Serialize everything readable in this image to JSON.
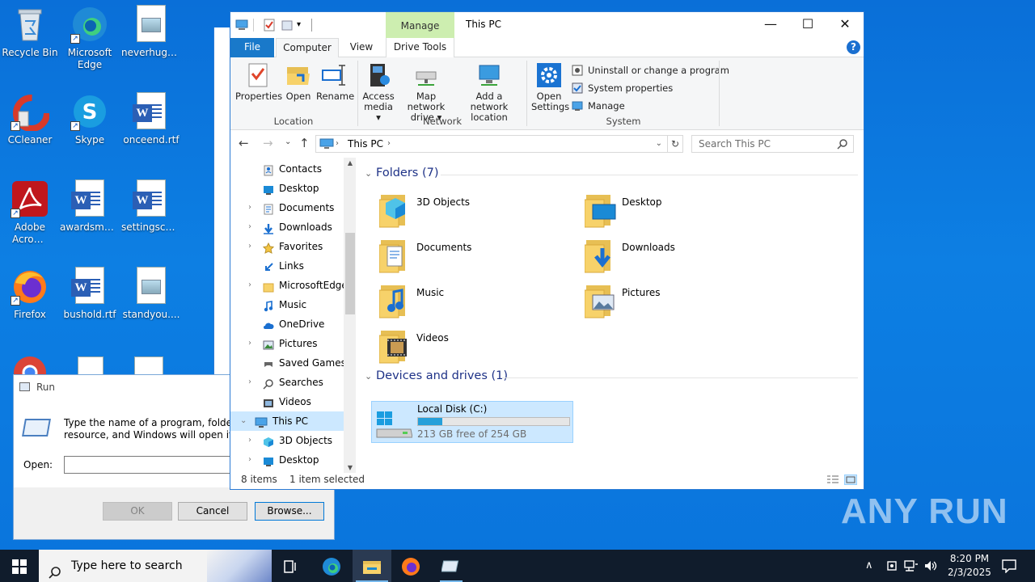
{
  "desktop": {
    "icons": [
      {
        "label": "Recycle Bin"
      },
      {
        "label": "Microsoft Edge"
      },
      {
        "label": "neverhuge..."
      },
      {
        "label": "CCleaner"
      },
      {
        "label": "Skype"
      },
      {
        "label": "onceend.rtf"
      },
      {
        "label": "Adobe Acrobat"
      },
      {
        "label": "awardsmar..."
      },
      {
        "label": "settingscho..."
      },
      {
        "label": "Firefox"
      },
      {
        "label": "bushold.rtf"
      },
      {
        "label": "standyou...."
      }
    ],
    "watermark": "ANY RUN"
  },
  "run_dialog": {
    "title": "Run",
    "description_line1": "Type the name of a program, folder, do",
    "description_line2": "resource, and Windows will open it for",
    "open_label": "Open:",
    "open_value": "",
    "ok_label": "OK",
    "cancel_label": "Cancel",
    "browse_label": "Browse..."
  },
  "explorer": {
    "manage_tab": "Manage",
    "title": "This PC",
    "controls": {
      "minimize": "—",
      "maximize": "☐",
      "close": "✕"
    },
    "tabs": [
      {
        "label": "File"
      },
      {
        "label": "Computer"
      },
      {
        "label": "View"
      },
      {
        "label": "Drive Tools"
      }
    ],
    "help": "?",
    "ribbon": {
      "location": {
        "group_label": "Location",
        "properties": "Properties",
        "open": "Open",
        "rename": "Rename"
      },
      "network": {
        "group_label": "Network",
        "access_media_1": "Access",
        "access_media_2": "media ▾",
        "map_drive_1": "Map network",
        "map_drive_2": "drive ▾",
        "add_location_1": "Add a network",
        "add_location_2": "location"
      },
      "system": {
        "group_label": "System",
        "open_settings_1": "Open",
        "open_settings_2": "Settings",
        "uninstall": "Uninstall or change a program",
        "system_properties": "System properties",
        "manage": "Manage"
      }
    },
    "address": {
      "path": "This PC",
      "search_placeholder": "Search This PC"
    },
    "nav_items": [
      {
        "label": "Contacts",
        "chevron": ""
      },
      {
        "label": "Desktop",
        "chevron": ""
      },
      {
        "label": "Documents",
        "chevron": "›"
      },
      {
        "label": "Downloads",
        "chevron": "›"
      },
      {
        "label": "Favorites",
        "chevron": "›"
      },
      {
        "label": "Links",
        "chevron": ""
      },
      {
        "label": "MicrosoftEdge",
        "chevron": "›"
      },
      {
        "label": "Music",
        "chevron": ""
      },
      {
        "label": "OneDrive",
        "chevron": ""
      },
      {
        "label": "Pictures",
        "chevron": "›"
      },
      {
        "label": "Saved Games",
        "chevron": ""
      },
      {
        "label": "Searches",
        "chevron": "›"
      },
      {
        "label": "Videos",
        "chevron": ""
      },
      {
        "label": "This PC",
        "chevron": "⌄"
      },
      {
        "label": "3D Objects",
        "chevron": "›"
      },
      {
        "label": "Desktop",
        "chevron": "›"
      }
    ],
    "folders_header": "Folders (7)",
    "folders": [
      {
        "label": "3D Objects"
      },
      {
        "label": "Desktop"
      },
      {
        "label": "Documents"
      },
      {
        "label": "Downloads"
      },
      {
        "label": "Music"
      },
      {
        "label": "Pictures"
      },
      {
        "label": "Videos"
      }
    ],
    "devices_header": "Devices and drives (1)",
    "drive": {
      "name": "Local Disk (C:)",
      "free_text": "213 GB free of 254 GB",
      "used_fraction": 0.16
    },
    "status": {
      "items": "8 items",
      "selected": "1 item selected"
    }
  },
  "taskbar": {
    "search_placeholder": "Type here to search",
    "time": "8:20 PM",
    "date": "2/3/2025"
  }
}
